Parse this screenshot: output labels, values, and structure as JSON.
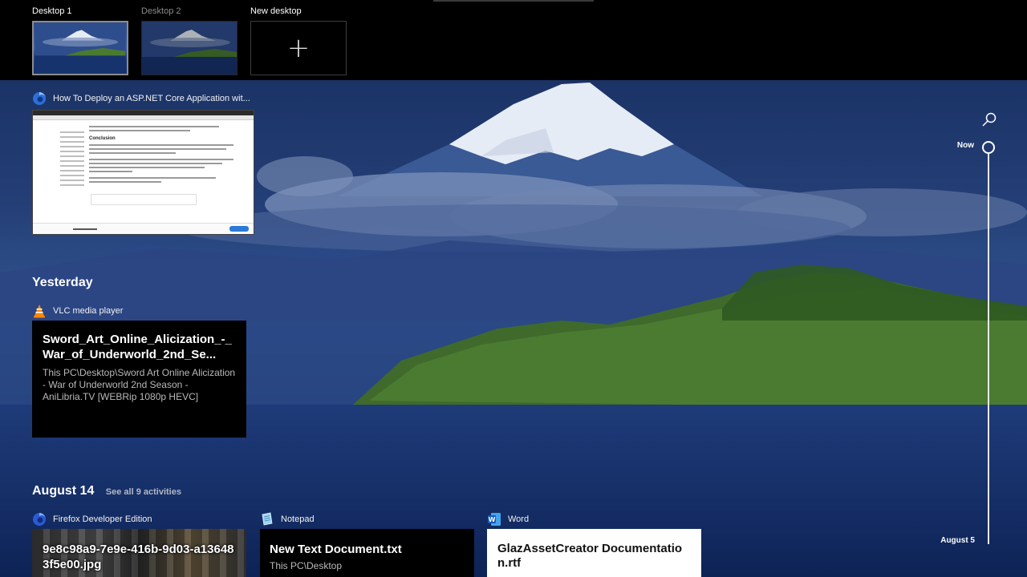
{
  "desktops": [
    {
      "label": "Desktop 1",
      "active": true
    },
    {
      "label": "Desktop 2",
      "active": false
    },
    {
      "label": "New desktop",
      "icon": "plus-icon"
    }
  ],
  "current": {
    "firefox_activity": {
      "app_icon": "firefox-icon",
      "title": "How To Deploy an ASP.NET Core Application wit...",
      "thumbnail_heading": "Conclusion"
    }
  },
  "yesterday": {
    "heading": "Yesterday",
    "vlc": {
      "app_icon": "vlc-icon",
      "app_name": "VLC media player",
      "title": "Sword_Art_Online_Alicization_-_War_of_Underworld_2nd_Se...",
      "path": "This PC\\Desktop\\Sword Art Online Alicization - War of Underworld 2nd Season - AniLibria.TV [WEBRip 1080p HEVC]"
    }
  },
  "august14": {
    "heading": "August 14",
    "see_all": "See all 9 activities",
    "cards": [
      {
        "app_icon": "firefox-developer-icon",
        "app_name": "Firefox Developer Edition",
        "title": "9e8c98a9-7e9e-416b-9d03-a136483f5e00.jpg"
      },
      {
        "app_icon": "notepad-icon",
        "app_name": "Notepad",
        "title": "New Text Document.txt",
        "path": "This PC\\Desktop"
      },
      {
        "app_icon": "word-icon",
        "app_name": "Word",
        "title": "GlazAssetCreator Documentation.rtf"
      }
    ]
  },
  "timeline": {
    "search_icon": "search-icon",
    "now_label": "Now",
    "end_label": "August 5"
  },
  "colors": {
    "accent": "#ffffff",
    "topbar": "#000000",
    "word_blue": "#2b579a"
  }
}
